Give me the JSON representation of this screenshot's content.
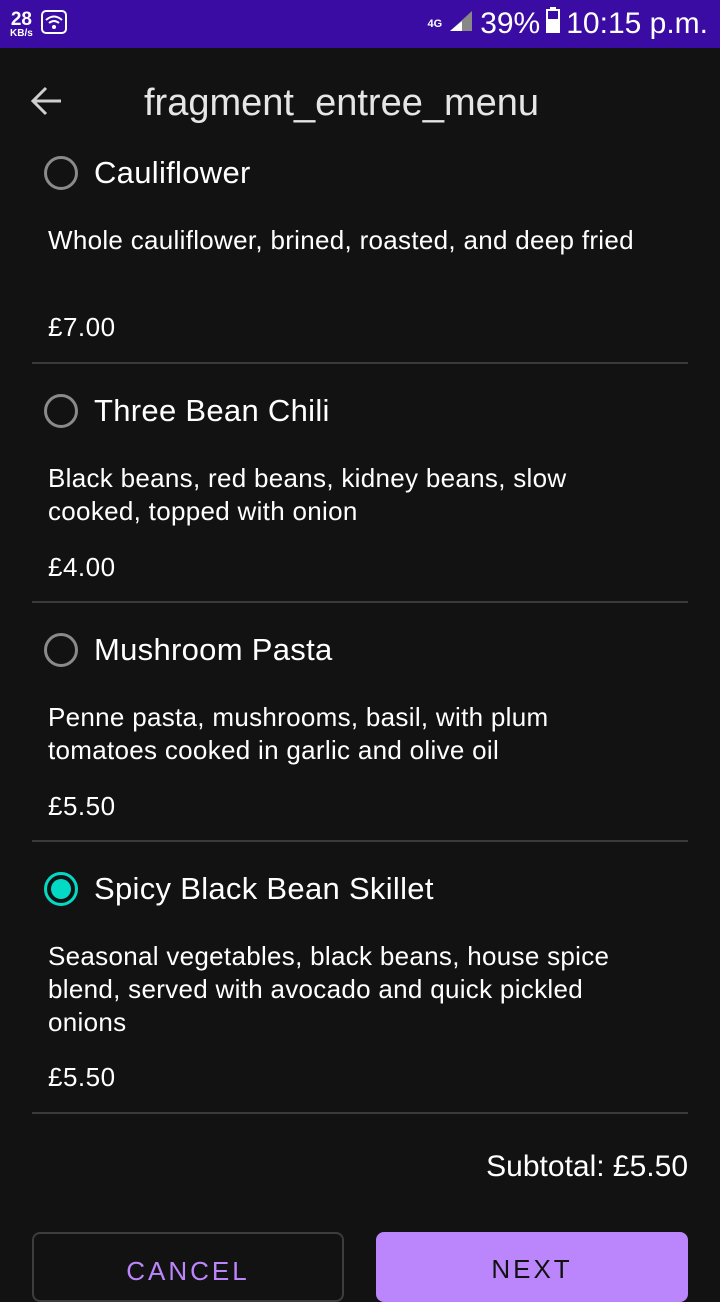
{
  "status_bar": {
    "speed_value": "28",
    "speed_unit": "KB/s",
    "network": "4G",
    "battery": "39%",
    "time": "10:15 p.m."
  },
  "app_bar": {
    "title": "fragment_entree_menu"
  },
  "items": [
    {
      "name": "Cauliflower",
      "description": "Whole cauliflower, brined, roasted, and deep fried",
      "price": "£7.00",
      "selected": false
    },
    {
      "name": "Three Bean Chili",
      "description": "Black beans, red beans, kidney beans, slow cooked, topped with onion",
      "price": "£4.00",
      "selected": false
    },
    {
      "name": "Mushroom Pasta",
      "description": "Penne pasta, mushrooms, basil, with plum tomatoes cooked in garlic and olive oil",
      "price": "£5.50",
      "selected": false
    },
    {
      "name": "Spicy Black Bean Skillet",
      "description": "Seasonal vegetables, black beans, house spice blend, served with avocado and quick pickled onions",
      "price": "£5.50",
      "selected": true
    }
  ],
  "subtotal": "Subtotal: £5.50",
  "buttons": {
    "cancel": "CANCEL",
    "next": "NEXT"
  },
  "colors": {
    "background": "#121212",
    "status_bar": "#3a0ca3",
    "accent_purple": "#bb86fc",
    "radio_checked": "#03dac5"
  }
}
